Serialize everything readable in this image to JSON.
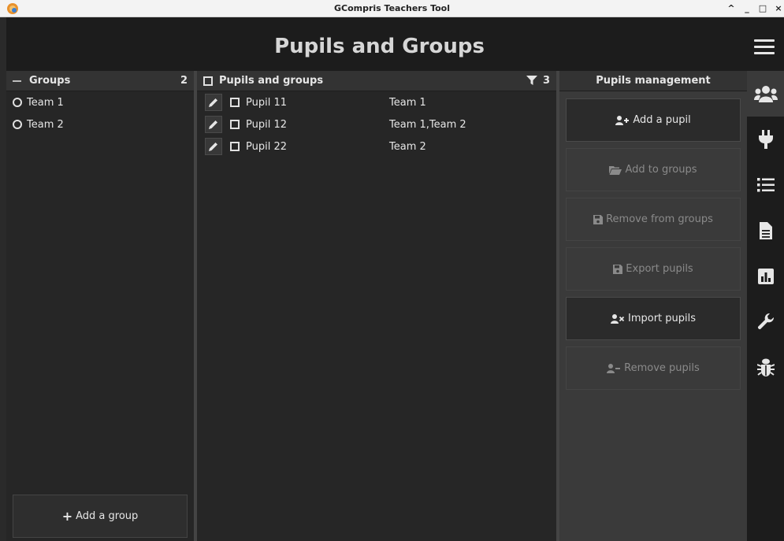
{
  "window": {
    "title": "GCompris Teachers Tool",
    "controls": [
      "^",
      "_",
      "□",
      "×"
    ]
  },
  "header": {
    "title": "Pupils and Groups"
  },
  "groups": {
    "heading": "Groups",
    "count": "2",
    "items": [
      {
        "label": "Team 1"
      },
      {
        "label": "Team 2"
      }
    ],
    "add_label": "Add a group"
  },
  "pupils": {
    "heading": "Pupils and groups",
    "count": "3",
    "rows": [
      {
        "name": "Pupil 11",
        "groups": "Team 1"
      },
      {
        "name": "Pupil 12",
        "groups": "Team 1,Team 2"
      },
      {
        "name": "Pupil 22",
        "groups": "Team 2"
      }
    ]
  },
  "management": {
    "heading": "Pupils management",
    "buttons": [
      {
        "label": "Add a pupil",
        "icon": "add-user-icon",
        "enabled": true
      },
      {
        "label": "Add to groups",
        "icon": "folder-open-icon",
        "enabled": false
      },
      {
        "label": "Remove from groups",
        "icon": "save-icon",
        "enabled": false
      },
      {
        "label": "Export pupils",
        "icon": "save-icon",
        "enabled": false
      },
      {
        "label": "Import pupils",
        "icon": "import-user-icon",
        "enabled": true
      },
      {
        "label": "Remove pupils",
        "icon": "remove-user-icon",
        "enabled": false
      }
    ]
  },
  "sidenav": {
    "items": [
      "users-icon",
      "plug-icon",
      "list-icon",
      "document-icon",
      "chart-icon",
      "wrench-icon",
      "bug-icon"
    ],
    "active": "users-icon"
  },
  "colors": {
    "background": "#2a2a2a",
    "panel": "#262626",
    "header": "#1c1c1c",
    "text": "#e6e6e6",
    "disabled_text": "#8a8a8a"
  }
}
